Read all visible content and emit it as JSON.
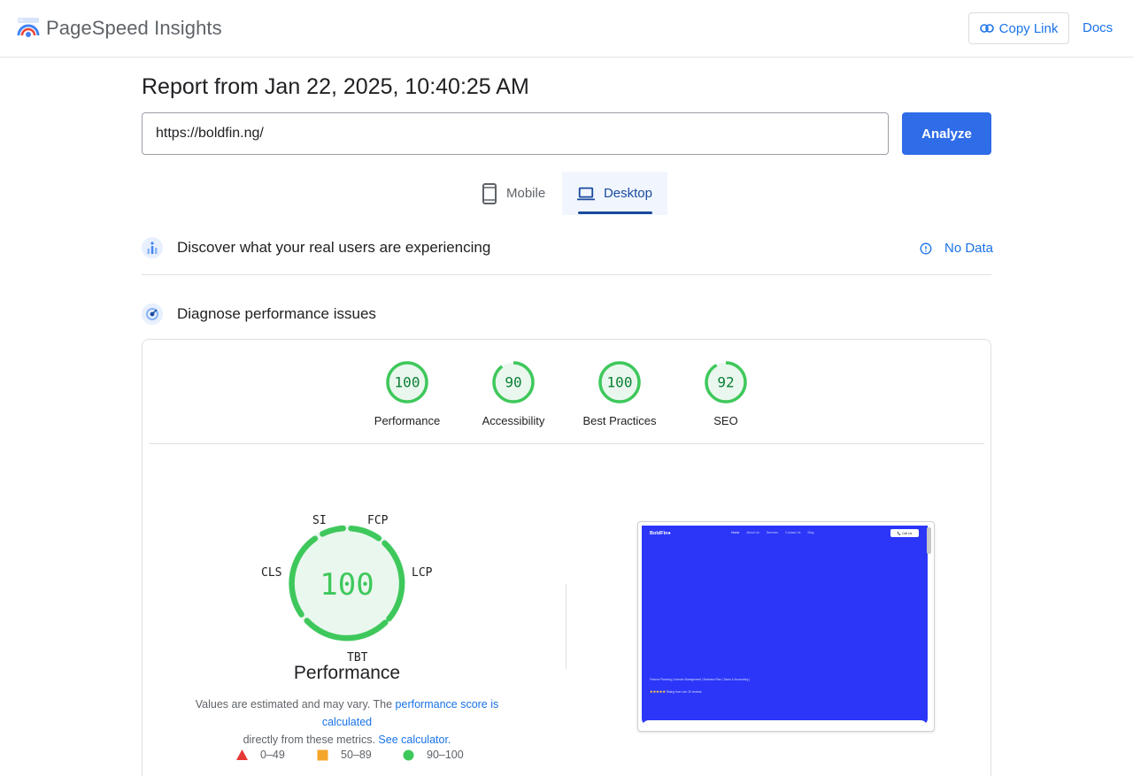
{
  "header": {
    "brand": "PageSpeed Insights",
    "copy_link": "Copy Link",
    "docs": "Docs"
  },
  "report": {
    "title": "Report from Jan 22, 2025, 10:40:25 AM",
    "url_value": "https://boldfin.ng/",
    "analyze": "Analyze"
  },
  "tabs": [
    {
      "label": "Mobile",
      "icon": "phone-icon",
      "active": false
    },
    {
      "label": "Desktop",
      "icon": "laptop-icon",
      "active": true
    }
  ],
  "real_users": {
    "title": "Discover what your real users are experiencing",
    "status": "No Data"
  },
  "diagnose": {
    "title": "Diagnose performance issues"
  },
  "scores": [
    {
      "label": "Performance",
      "value": "100"
    },
    {
      "label": "Accessibility",
      "value": "90"
    },
    {
      "label": "Best Practices",
      "value": "100"
    },
    {
      "label": "SEO",
      "value": "92"
    }
  ],
  "performance": {
    "score": "100",
    "title": "Performance",
    "metrics": {
      "si": "SI",
      "fcp": "FCP",
      "lcp": "LCP",
      "tbt": "TBT",
      "cls": "CLS"
    },
    "note_prefix": "Values are estimated and may vary. The ",
    "note_link1": "performance score is calculated",
    "note_middle": " directly from these metrics. ",
    "note_link2": "See calculator."
  },
  "legend": [
    {
      "range": "0–49",
      "color": "#e53935",
      "shape": "triangle"
    },
    {
      "range": "50–89",
      "color": "#f4a62a",
      "shape": "square"
    },
    {
      "range": "90–100",
      "color": "#3ec85b",
      "shape": "circle"
    }
  ],
  "thumbnail": {
    "brand": "BoldFin●",
    "nav": [
      "Home",
      "About Us",
      "Services",
      "Contact Us",
      "Blog"
    ],
    "call": "📞 Call Us",
    "services": "Finance Planning  |  Investor Management  |  Business Plan  |  Taxes & Accounting |",
    "rating_stars": "★★★★★",
    "rating_text": " Rating from over 26 reviews"
  },
  "colors": {
    "accent": "#1a73e8",
    "analyze_button": "#2f6ce8",
    "pass_green": "#3ec85b",
    "score_text_green": "#0a7f34",
    "thumbnail_blue": "#2b36f8"
  }
}
